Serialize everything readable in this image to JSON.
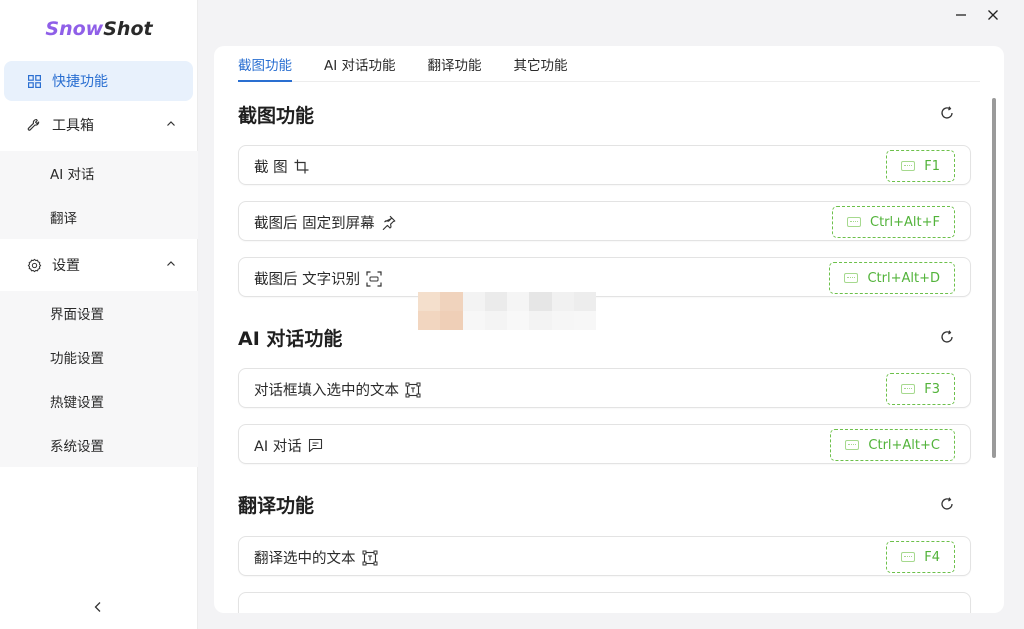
{
  "app": {
    "logo_a": "Snow",
    "logo_b": "Shot"
  },
  "sidebar": {
    "items": [
      {
        "label": "快捷功能",
        "icon": "grid-icon",
        "active": true
      },
      {
        "label": "工具箱",
        "icon": "wrench-icon",
        "expanded": true
      },
      {
        "label": "设置",
        "icon": "gear-icon",
        "expanded": true
      }
    ],
    "toolbox_sub": [
      "AI 对话",
      "翻译"
    ],
    "settings_sub": [
      "界面设置",
      "功能设置",
      "热键设置",
      "系统设置"
    ],
    "collapse_icon": "chevron-left-icon"
  },
  "window": {
    "minimize_icon": "minimize-icon",
    "close_icon": "close-icon"
  },
  "tabs": [
    "截图功能",
    "AI 对话功能",
    "翻译功能",
    "其它功能"
  ],
  "sections": [
    {
      "title": "截图功能",
      "rows": [
        {
          "label": "截 图",
          "icon": "crop-icon",
          "hotkey": "F1"
        },
        {
          "label": "截图后 固定到屏幕",
          "icon": "pin-icon",
          "hotkey": "Ctrl+Alt+F"
        },
        {
          "label": "截图后 文字识别",
          "icon": "ocr-icon",
          "hotkey": "Ctrl+Alt+D"
        }
      ]
    },
    {
      "title": "AI 对话功能",
      "rows": [
        {
          "label": "对话框填入选中的文本",
          "icon": "text-select-icon",
          "hotkey": "F3"
        },
        {
          "label": "AI 对话",
          "icon": "chat-icon",
          "hotkey": "Ctrl+Alt+C"
        }
      ]
    },
    {
      "title": "翻译功能",
      "rows": [
        {
          "label": "翻译选中的文本",
          "icon": "text-select-icon",
          "hotkey": "F4"
        }
      ]
    }
  ],
  "colors": {
    "accent": "#2a6fd1",
    "brand": "#8f5fe8",
    "hotkey_green": "#52b33a"
  }
}
